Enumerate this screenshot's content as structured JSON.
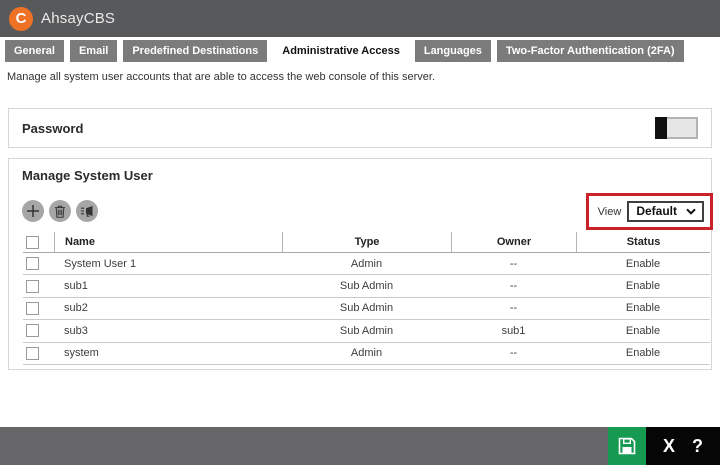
{
  "header": {
    "app_title": "AhsayCBS",
    "logo_letter": "C"
  },
  "tabs": [
    {
      "label": "General",
      "active": false
    },
    {
      "label": "Email",
      "active": false
    },
    {
      "label": "Predefined Destinations",
      "active": false
    },
    {
      "label": "Administrative Access",
      "active": true
    },
    {
      "label": "Languages",
      "active": false
    },
    {
      "label": "Two-Factor Authentication (2FA)",
      "active": false
    }
  ],
  "description": "Manage all system user accounts that are able to access the web console of this server.",
  "password_section": {
    "title": "Password",
    "toggle_state": "off"
  },
  "manage_section": {
    "title": "Manage System User",
    "toolbar": {
      "add_icon": "plus-icon",
      "delete_icon": "trash-icon",
      "broadcast_icon": "megaphone-icon"
    },
    "view": {
      "label": "View",
      "selected": "Default",
      "options": [
        "Default"
      ]
    },
    "table": {
      "columns": [
        "Name",
        "Type",
        "Owner",
        "Status"
      ],
      "rows": [
        {
          "name": "System User 1",
          "type": "Admin",
          "owner": "--",
          "status": "Enable"
        },
        {
          "name": "sub1",
          "type": "Sub Admin",
          "owner": "--",
          "status": "Enable"
        },
        {
          "name": "sub2",
          "type": "Sub Admin",
          "owner": "--",
          "status": "Enable"
        },
        {
          "name": "sub3",
          "type": "Sub Admin",
          "owner": "sub1",
          "status": "Enable"
        },
        {
          "name": "system",
          "type": "Admin",
          "owner": "--",
          "status": "Enable"
        }
      ]
    }
  },
  "footer": {
    "save_icon": "floppy-disk-icon",
    "close_label": "X",
    "help_label": "?"
  },
  "colors": {
    "header_bg": "#58595b",
    "accent_orange": "#ee7125",
    "tab_inactive": "#7b7b7b",
    "highlight_red": "#cb2128",
    "footer_bar": "#666668",
    "save_green": "#169a52",
    "footer_black": "#060606"
  }
}
